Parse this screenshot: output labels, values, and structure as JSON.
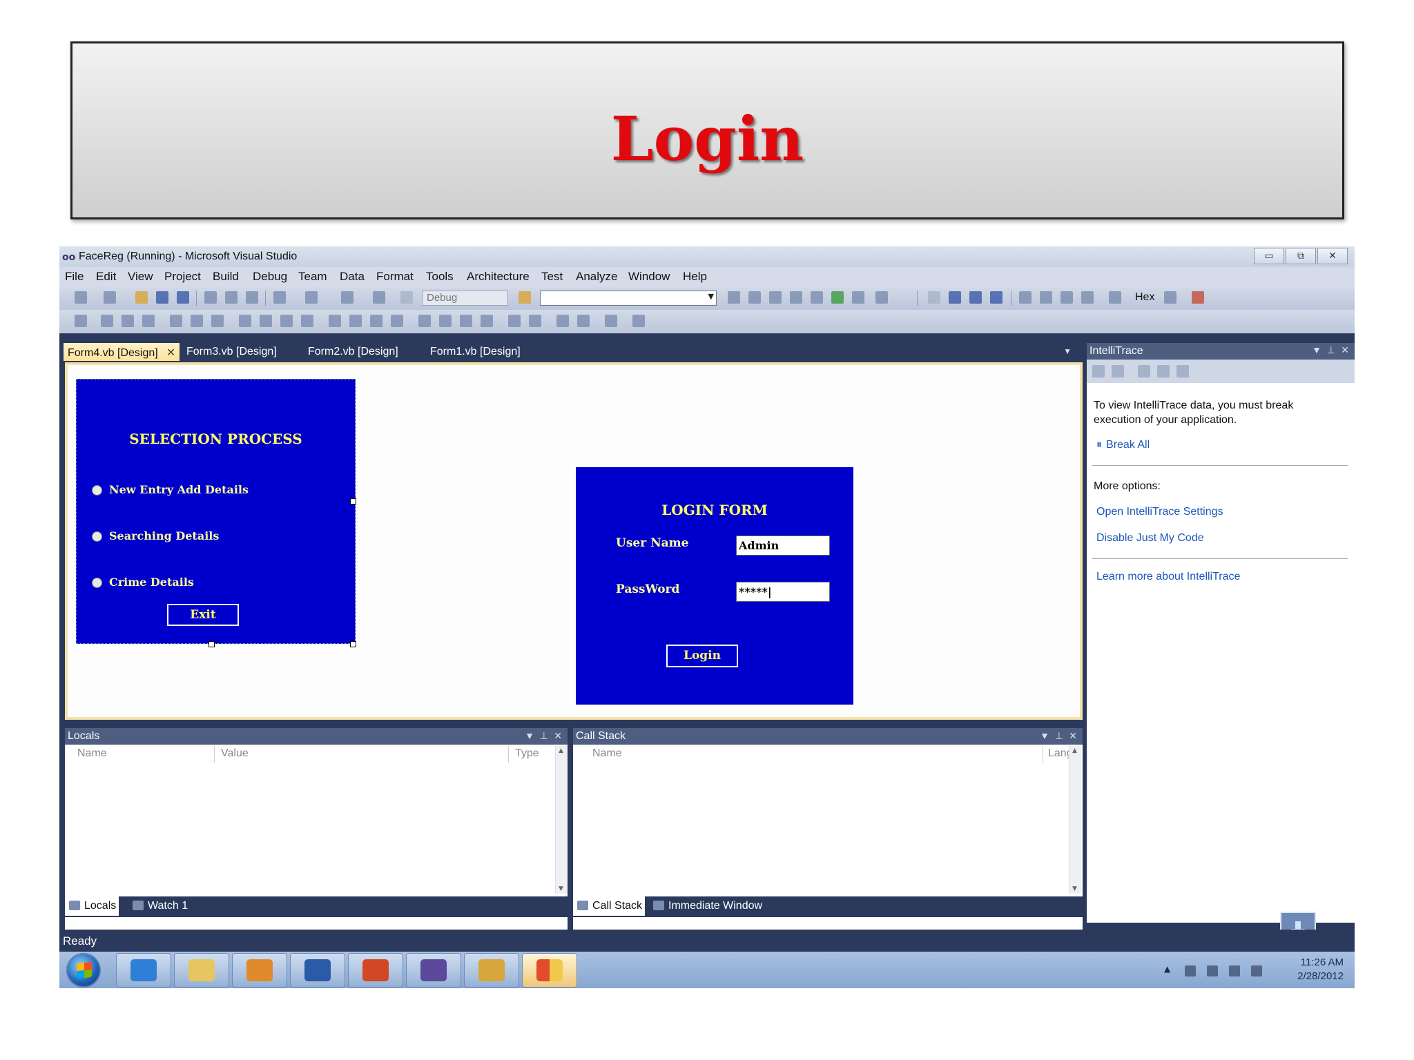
{
  "slide": {
    "title": "Login"
  },
  "window": {
    "title": "FaceReg (Running) - Microsoft Visual Studio",
    "logo_text": "∞"
  },
  "menu": [
    "File",
    "Edit",
    "View",
    "Project",
    "Build",
    "Debug",
    "Team",
    "Data",
    "Format",
    "Tools",
    "Architecture",
    "Test",
    "Analyze",
    "Window",
    "Help"
  ],
  "toolbar": {
    "config": "Debug",
    "hex_label": "Hex"
  },
  "doc_tabs": [
    "Form4.vb [Design]",
    "Form3.vb [Design]",
    "Form2.vb [Design]",
    "Form1.vb [Design]"
  ],
  "selection_form": {
    "heading": "SELECTION PROCESS",
    "options": [
      "New Entry Add Details",
      "Searching Details",
      "Crime Details"
    ],
    "exit_label": "Exit"
  },
  "login_form": {
    "heading": "LOGIN FORM",
    "username_label": "User Name",
    "username_value": "Admin",
    "password_label": "PassWord",
    "password_value": "*****|",
    "login_label": "Login"
  },
  "intellitrace": {
    "title": "IntelliTrace",
    "message": "To view IntelliTrace data, you must break execution of your application.",
    "break_all": "Break All",
    "more_options": "More options:",
    "open_settings": "Open IntelliTrace Settings",
    "disable_jmc": "Disable Just My Code",
    "learn_more": "Learn more about IntelliTrace"
  },
  "locals": {
    "title": "Locals",
    "columns": [
      "Name",
      "Value",
      "Type"
    ],
    "tabs": [
      "Locals",
      "Watch 1"
    ]
  },
  "callstack": {
    "title": "Call Stack",
    "columns": [
      "Name",
      "Lang"
    ],
    "tabs": [
      "Call Stack",
      "Immediate Window"
    ]
  },
  "status": "Ready",
  "clock": {
    "time": "11:26 AM",
    "date": "2/28/2012"
  },
  "colors": {
    "accent_title": "#e0090e",
    "form_bg": "#0000cc",
    "form_text": "#ffff66",
    "ide_frame": "#2b3a5c"
  }
}
